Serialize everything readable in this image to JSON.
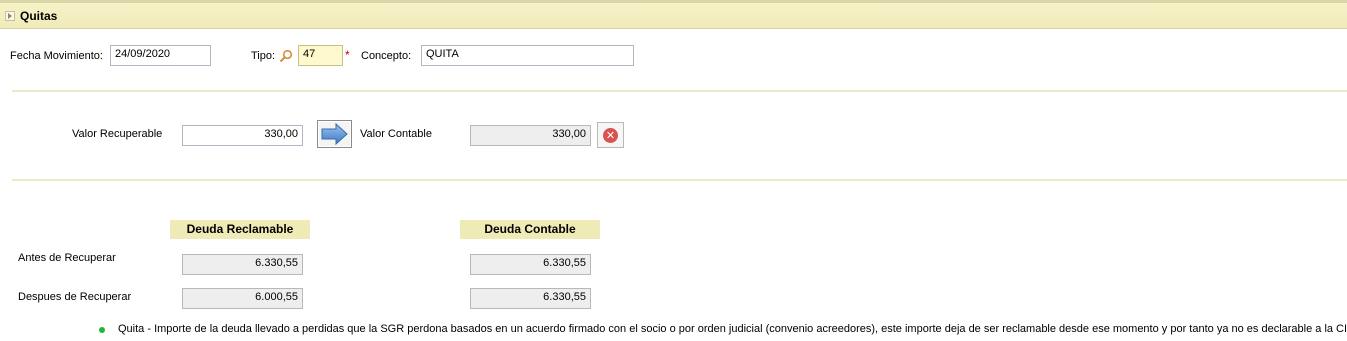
{
  "panel": {
    "title": "Quitas"
  },
  "movement": {
    "fecha_label": "Fecha Movimiento:",
    "fecha_value": "24/09/2020",
    "tipo_label": "Tipo:",
    "tipo_value": "47",
    "required_mark": "*",
    "concepto_label": "Concepto:",
    "concepto_value": "QUITA"
  },
  "values": {
    "recuperable_label": "Valor Recuperable",
    "recuperable_value": "330,00",
    "contable_label": "Valor Contable",
    "contable_value": "330,00"
  },
  "debt": {
    "reclamable_header": "Deuda Reclamable",
    "contable_header": "Deuda Contable",
    "antes_label": "Antes de Recuperar",
    "despues_label": "Despues de Recuperar",
    "antes_reclamable": "6.330,55",
    "antes_contable": "6.330,55",
    "despues_reclamable": "6.000,55",
    "despues_contable": "6.330,55"
  },
  "note": "Quita - Importe de la deuda llevado a perdidas que la SGR perdona basados en un acuerdo firmado con el socio o por orden judicial (convenio acreedores), este importe deja de ser reclamable desde ese momento y por tanto ya no es declarable a la CIRBE.",
  "icons": {
    "expand": "expand-icon",
    "search": "search-icon",
    "arrow": "arrow-right-icon",
    "cancel": "cancel-icon",
    "bullet": "bullet-icon"
  },
  "colors": {
    "header_bg": "#efeab8",
    "accent_arrow": "#5b8fd0",
    "cancel": "#d9534f",
    "bullet": "#2bb52b",
    "required": "#cc0000"
  }
}
